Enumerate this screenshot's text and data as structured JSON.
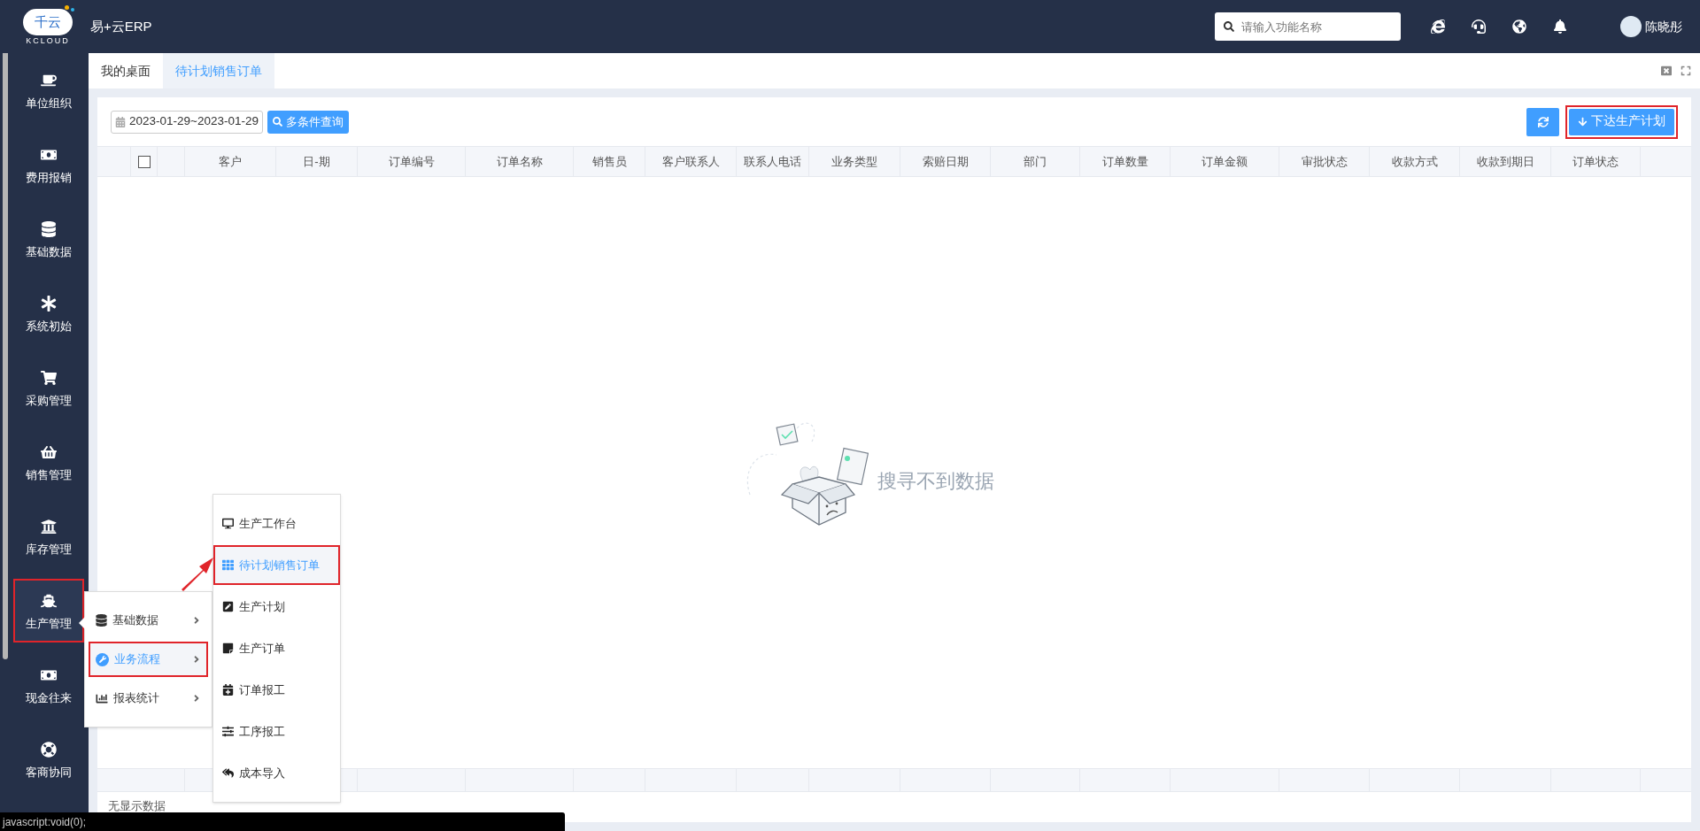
{
  "header": {
    "logo_text": "千云",
    "logo_subtext": "KCLOUD",
    "title": "易+云ERP",
    "search": {
      "placeholder": "请输入功能名称"
    },
    "user": {
      "name": "陈晓彤"
    }
  },
  "sidebar": {
    "items": [
      {
        "label": "单位组织",
        "selected": false,
        "annotated": false
      },
      {
        "label": "费用报销",
        "selected": false,
        "annotated": false
      },
      {
        "label": "基础数据",
        "selected": false,
        "annotated": false
      },
      {
        "label": "系统初始",
        "selected": false,
        "annotated": false
      },
      {
        "label": "采购管理",
        "selected": false,
        "annotated": false
      },
      {
        "label": "销售管理",
        "selected": false,
        "annotated": false
      },
      {
        "label": "库存管理",
        "selected": false,
        "annotated": false
      },
      {
        "label": "生产管理",
        "selected": true,
        "annotated": true
      },
      {
        "label": "现金往来",
        "selected": false,
        "annotated": false
      },
      {
        "label": "客商协同",
        "selected": false,
        "annotated": false
      }
    ]
  },
  "tabs": [
    {
      "label": "我的桌面",
      "selected": false
    },
    {
      "label": "待计划销售订单",
      "selected": true
    }
  ],
  "toolbar": {
    "date_range": "2023-01-29~2023-01-29",
    "query_button": "多条件查询",
    "submit_button": {
      "label": "下达生产计划",
      "annotated": true
    }
  },
  "table": {
    "select_all": {
      "checked": false
    },
    "columns": [
      "客户",
      "日-期",
      "订单编号",
      "订单名称",
      "销售员",
      "客户联系人",
      "联系人电话",
      "业务类型",
      "索赔日期",
      "部门",
      "订单数量",
      "订单金额",
      "审批状态",
      "收款方式",
      "收款到期日",
      "订单状态"
    ],
    "empty_message": "搜寻不到数据",
    "footer_text": "无显示数据"
  },
  "menu": {
    "items": [
      {
        "label": "基础数据",
        "selected": false,
        "annotated": false
      },
      {
        "label": "业务流程",
        "selected": true,
        "annotated": true
      },
      {
        "label": "报表统计",
        "selected": false,
        "annotated": false
      }
    ]
  },
  "submenu": {
    "items": [
      {
        "label": "生产工作台",
        "selected": false,
        "annotated": false
      },
      {
        "label": "待计划销售订单",
        "selected": true,
        "annotated": true
      },
      {
        "label": "生产计划",
        "selected": false,
        "annotated": false
      },
      {
        "label": "生产订单",
        "selected": false,
        "annotated": false
      },
      {
        "label": "订单报工",
        "selected": false,
        "annotated": false
      },
      {
        "label": "工序报工",
        "selected": false,
        "annotated": false
      },
      {
        "label": "成本导入",
        "selected": false,
        "annotated": false
      }
    ]
  },
  "status_bar": "javascript:void(0);"
}
